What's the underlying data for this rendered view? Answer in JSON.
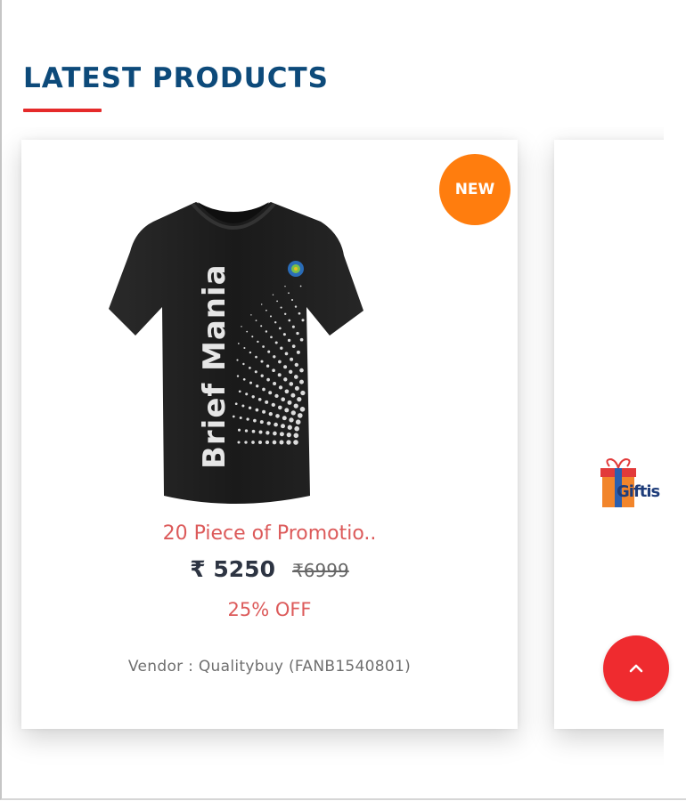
{
  "section": {
    "title": "LATEST PRODUCTS"
  },
  "products": [
    {
      "badge": "NEW",
      "shirt_print": "Brief Mania",
      "name": "20 Piece of Promotio..",
      "price": "₹ 5250",
      "old_price": "₹6999",
      "discount": "25% OFF",
      "vendor": "Vendor : Qualitybuy (FANB1540801)"
    }
  ],
  "next_card": {
    "logo_text": "Giftis"
  },
  "colors": {
    "title": "#0d4a7a",
    "underline": "#e52a2a",
    "badge": "#ff7d0e",
    "accent_red": "#dc5a5a",
    "scroll_button": "#ef2b2f"
  },
  "icons": {
    "scroll_top": "chevron-up-icon"
  }
}
